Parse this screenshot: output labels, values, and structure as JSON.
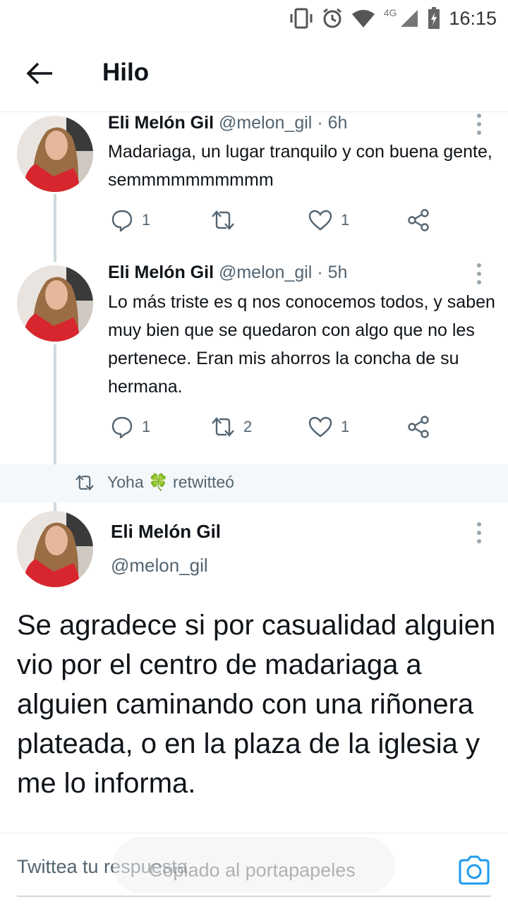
{
  "status_bar": {
    "network": "4G",
    "time": "16:15"
  },
  "header": {
    "title": "Hilo"
  },
  "thread": [
    {
      "name": "Eli Melón Gil",
      "handle": "@melon_gil",
      "time": "· 6h",
      "text": "Madariaga, un lugar tranquilo y con buena gente, semmmmmmmmmm",
      "replies": "1",
      "retweets": "",
      "likes": "1"
    },
    {
      "name": "Eli Melón Gil",
      "handle": "@melon_gil",
      "time": "· 5h",
      "text": "Lo más triste es q nos conocemos todos, y saben muy bien que se quedaron con algo que no les pertenece. Eran mis ahorros la concha de su hermana.",
      "replies": "1",
      "retweets": "2",
      "likes": "1"
    }
  ],
  "retweet_bar": {
    "user": "Yoha",
    "emoji": "🍀",
    "label": "retwitteó"
  },
  "main_tweet": {
    "name": "Eli Melón Gil",
    "handle": "@melon_gil",
    "text": "Se agradece si por casualidad alguien vio por el centro de madariaga a alguien caminando con una riñonera plateada, o en la plaza de la iglesia y me lo informa."
  },
  "reply": {
    "placeholder": "Twittea tu respuesta"
  },
  "toast": {
    "text": "Copiado al portapapeles"
  },
  "colors": {
    "text": "#0f1419",
    "secondary": "#536471",
    "accent": "#1d9bf0",
    "avatar_dress": "#d8262f"
  }
}
